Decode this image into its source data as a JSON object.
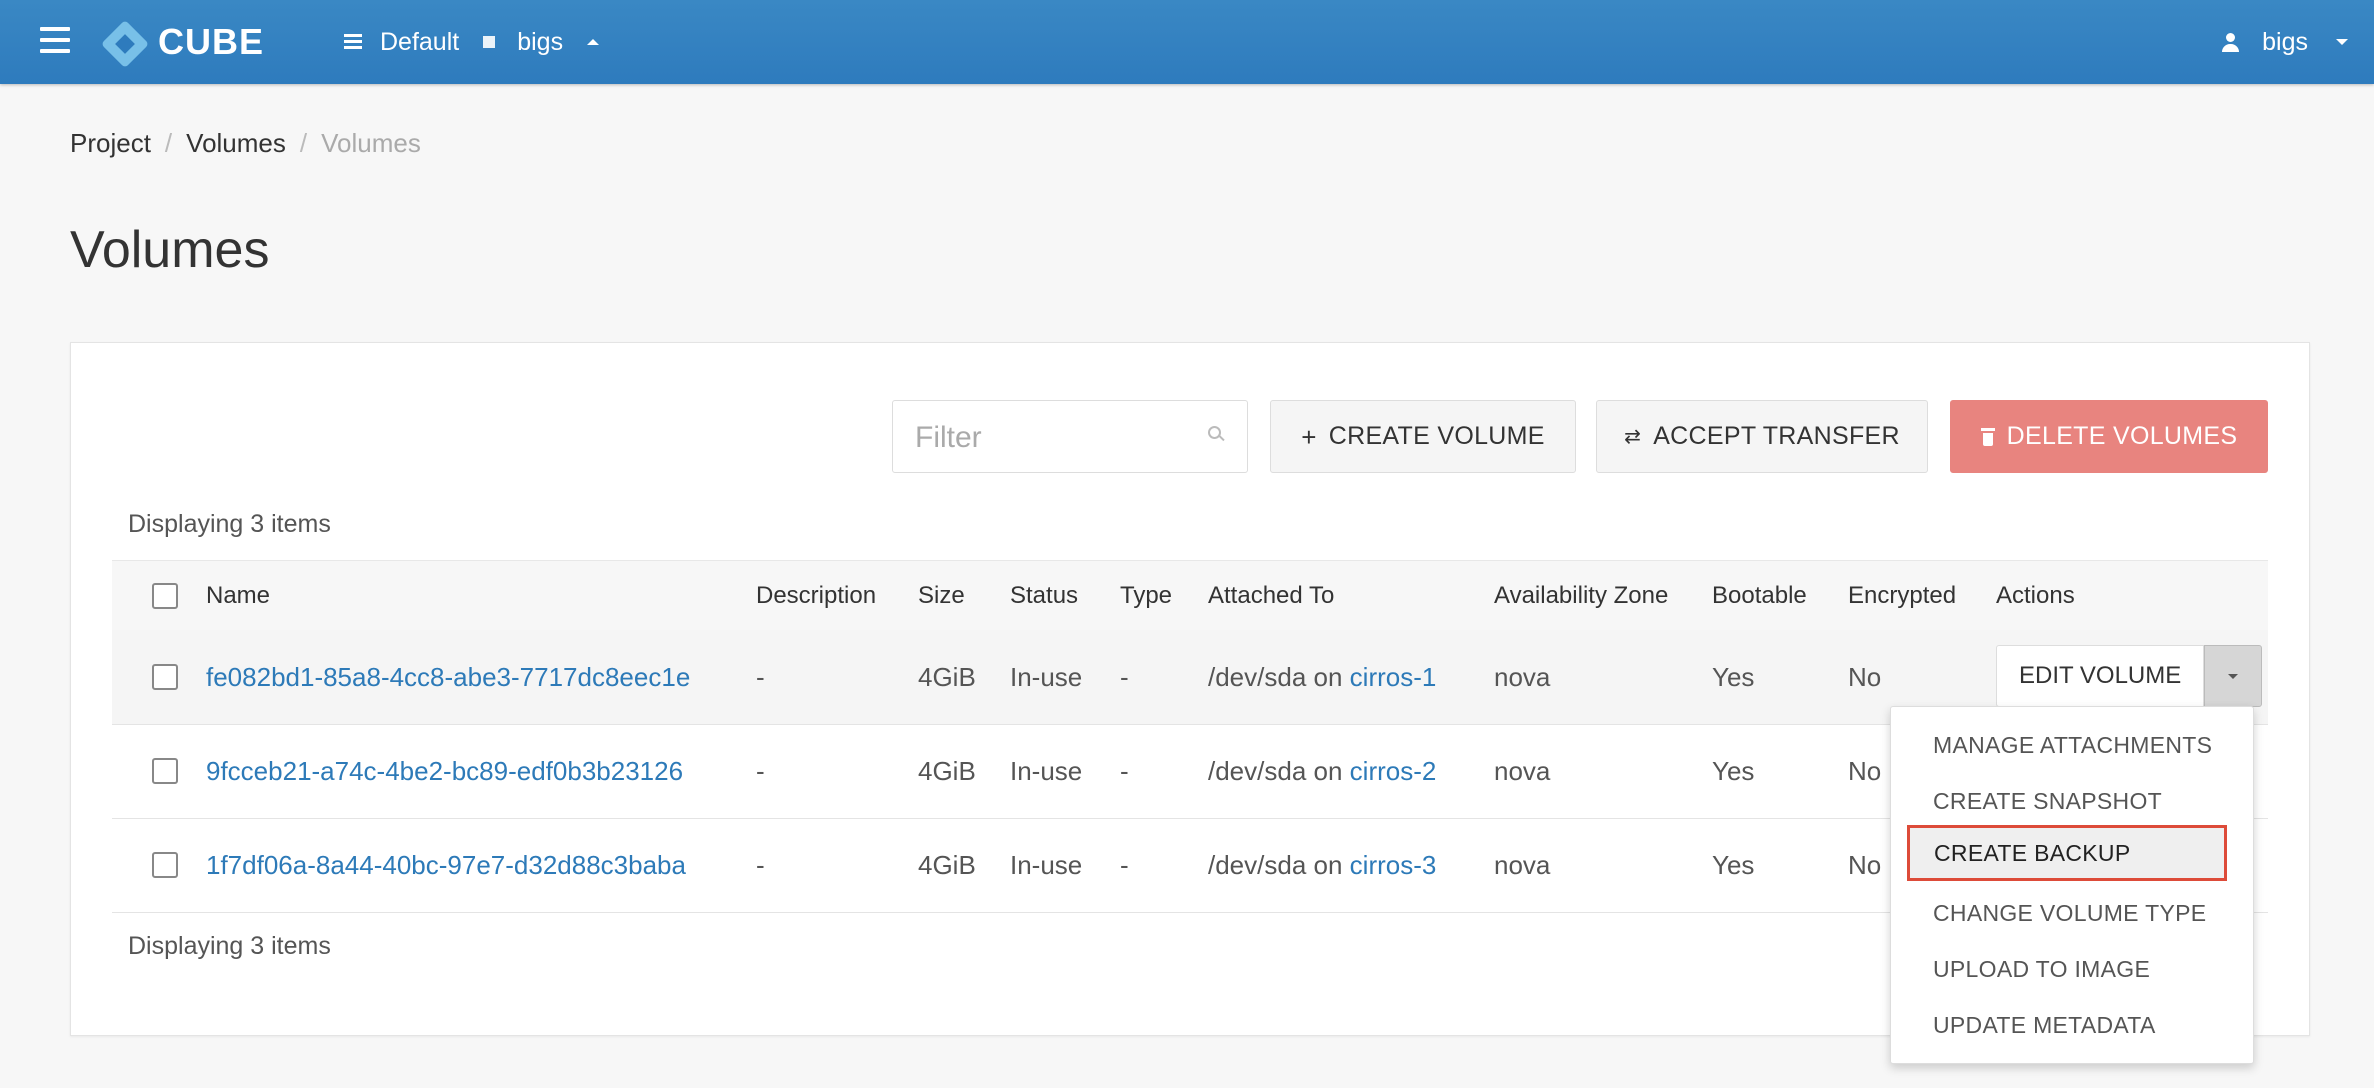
{
  "navbar": {
    "brand": "CUBE",
    "domain": "Default",
    "project": "bigs",
    "user": "bigs"
  },
  "breadcrumb": [
    "Project",
    "Volumes",
    "Volumes"
  ],
  "page": {
    "title": "Volumes"
  },
  "toolbar": {
    "filter_placeholder": "Filter",
    "create_volume": "CREATE VOLUME",
    "accept_transfer": "ACCEPT TRANSFER",
    "delete_volumes": "DELETE VOLUMES"
  },
  "table": {
    "count_text": "Displaying 3 items",
    "columns": [
      "Name",
      "Description",
      "Size",
      "Status",
      "Type",
      "Attached To",
      "Availability Zone",
      "Bootable",
      "Encrypted",
      "Actions"
    ],
    "rows": [
      {
        "name": "fe082bd1-85a8-4cc8-abe3-7717dc8eec1e",
        "description": "-",
        "size": "4GiB",
        "status": "In-use",
        "type": "-",
        "attached_prefix": "/dev/sda on",
        "attached_instance": "cirros-1",
        "az": "nova",
        "bootable": "Yes",
        "encrypted": "No"
      },
      {
        "name": "9fcceb21-a74c-4be2-bc89-edf0b3b23126",
        "description": "-",
        "size": "4GiB",
        "status": "In-use",
        "type": "-",
        "attached_prefix": "/dev/sda on",
        "attached_instance": "cirros-2",
        "az": "nova",
        "bootable": "Yes",
        "encrypted": "No"
      },
      {
        "name": "1f7df06a-8a44-40bc-97e7-d32d88c3baba",
        "description": "-",
        "size": "4GiB",
        "status": "In-use",
        "type": "-",
        "attached_prefix": "/dev/sda on",
        "attached_instance": "cirros-3",
        "az": "nova",
        "bootable": "Yes",
        "encrypted": "No"
      }
    ],
    "row_action": "EDIT VOLUME"
  },
  "dropdown": {
    "items": [
      "MANAGE ATTACHMENTS",
      "CREATE SNAPSHOT",
      "CREATE BACKUP",
      "CHANGE VOLUME TYPE",
      "UPLOAD TO IMAGE",
      "UPDATE METADATA"
    ],
    "highlighted": "CREATE BACKUP"
  },
  "colors": {
    "navbar": "#2e7bbd",
    "link": "#2d7ab8",
    "danger": "#e8847f",
    "highlight_border": "#dd4b39"
  }
}
